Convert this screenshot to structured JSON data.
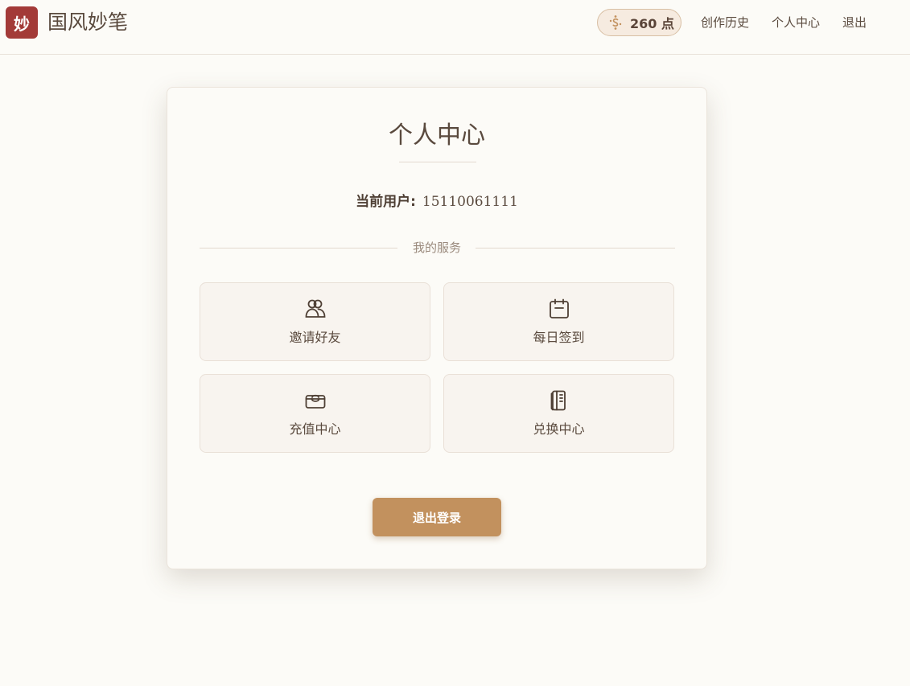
{
  "header": {
    "logo_char": "妙",
    "brand": "国风妙笔",
    "points": "260 点",
    "nav": [
      "创作历史",
      "个人中心",
      "退出"
    ]
  },
  "profile": {
    "title": "个人中心",
    "user_label": "当前用户:",
    "user_value": "15110061111",
    "services_label": "我的服务",
    "services": [
      {
        "label": "邀请好友",
        "icon": "invite-friends-icon"
      },
      {
        "label": "每日签到",
        "icon": "calendar-icon"
      },
      {
        "label": "充值中心",
        "icon": "recharge-wallet-icon"
      },
      {
        "label": "兑换中心",
        "icon": "exchange-book-icon"
      }
    ],
    "logout_label": "退出登录"
  },
  "colors": {
    "background": "#fcfbf7",
    "logo": "#a33a38",
    "accent": "#c2915e",
    "text": "#5a4a3e"
  }
}
